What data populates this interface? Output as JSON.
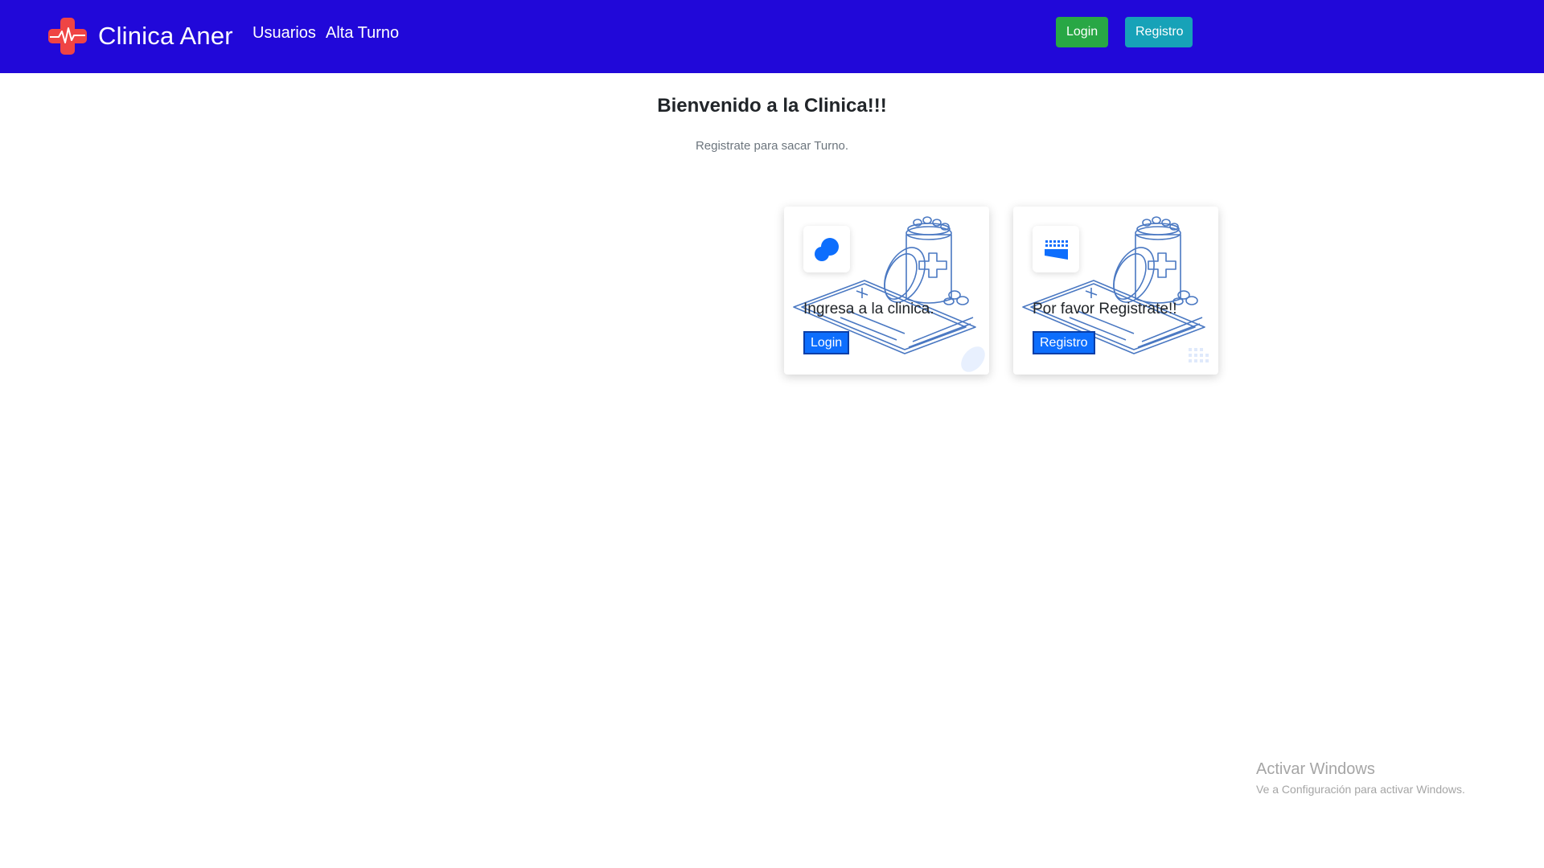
{
  "navbar": {
    "brand": "Clinica Aner",
    "links": [
      "Usuarios",
      "Alta Turno"
    ],
    "login_label": "Login",
    "registro_label": "Registro",
    "logo_icon": "medical-cross-heartbeat-icon",
    "colors": {
      "background": "#2108d9",
      "login": "#28a745",
      "registro": "#17a2b8",
      "logo": "#ef4444"
    }
  },
  "main": {
    "title": "Bienvenido a la Clinica!!!",
    "subtitle": "Registrate para sacar Turno."
  },
  "cards": [
    {
      "text": "Ingresa a la clinica.",
      "button": "Login",
      "icon": "login-blob-icon"
    },
    {
      "text": "Por favor Registrate!!",
      "button": "Registro",
      "icon": "register-dots-icon"
    }
  ],
  "watermark": {
    "title": "Activar Windows",
    "subtitle": "Ve a Configuración para activar Windows."
  }
}
